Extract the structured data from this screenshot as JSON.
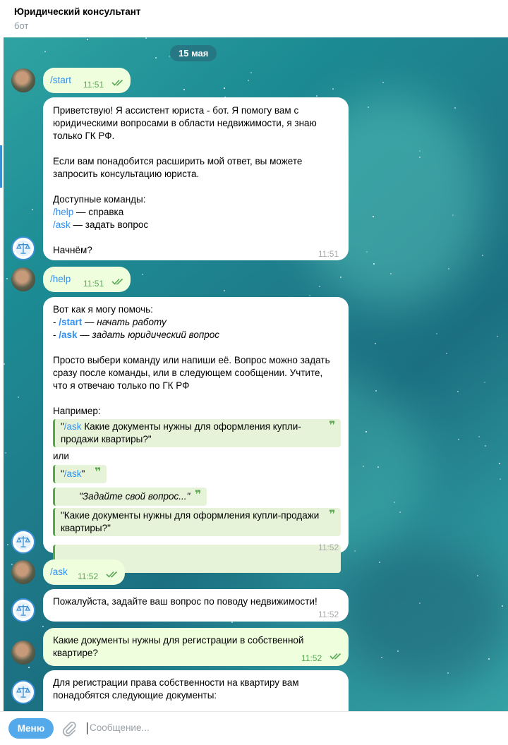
{
  "header": {
    "title": "Юридический консультант",
    "subtitle": "бот"
  },
  "date_divider": "15 мая",
  "messages": {
    "m1": {
      "cmd": "/start",
      "time": "11:51"
    },
    "m2": {
      "l1": "Приветствую! Я ассистент юриста - бот. Я помогу вам с",
      "l2": "юридическими вопросами в области недвижимости, я знаю",
      "l3": "только ГК РФ.",
      "l4": "Если вам понадобится расширить мой ответ, вы можете",
      "l5": "запросить консультацию юриста.",
      "l6": "Доступные команды:",
      "help_cmd": "/help",
      "help_desc": " — справка",
      "ask_cmd": "/ask",
      "ask_desc": " — задать вопрос",
      "l9": "Начнём?",
      "time": "11:51"
    },
    "m3": {
      "cmd": "/help",
      "time": "11:51"
    },
    "m4": {
      "l1": "Вот как я могу помочь:",
      "start_prefix": "- ",
      "start_cmd": "/start",
      "start_desc": " — начать работу",
      "ask_prefix": "- ",
      "ask_cmd": "/ask",
      "ask_desc": " — задать юридический вопрос",
      "p1": "Просто выбери команду или напиши её. Вопрос можно задать",
      "p2": "сразу после команды, или в следующем сообщении. Учтите,",
      "p3": "что я отвечаю только по ГК РФ",
      "example_label": "Например:",
      "q1_open": "\"",
      "q1_cmd": "/ask",
      "q1_text": " Какие документы нужны для оформления купли-",
      "q1_text2": "продажи квартиры?\"",
      "or": "или",
      "q2_open": "\"",
      "q2_cmd": "/ask",
      "q2_close": "\"",
      "q3": "\"Задайте свой вопрос...\"",
      "q4_1": "\"Какие документы нужны для оформления купли-продажи",
      "q4_2": "квартиры?\"",
      "time": "11:52"
    },
    "m5": {
      "cmd": "/ask",
      "time": "11:52"
    },
    "m6": {
      "text": "Пожалуйста, задайте ваш вопрос по поводу недвижимости!",
      "time": "11:52"
    },
    "m7": {
      "l1": "Какие документы нужны для регистрации в собственной",
      "l2": "квартире?",
      "time": "11:52"
    },
    "m8": {
      "l1": "Для регистрации права собственности на квартиру вам",
      "l2": "понадобятся следующие документы:"
    }
  },
  "composer": {
    "menu_label": "Меню",
    "placeholder": "Сообщение..."
  },
  "colors": {
    "accent": "#3390ec",
    "outgoing_bubble": "#effedd",
    "quote_bar": "#56a94a"
  },
  "icons": {
    "attach": "paperclip-icon",
    "read_status": "double-check-icon",
    "bot_avatar": "scales-icon"
  }
}
